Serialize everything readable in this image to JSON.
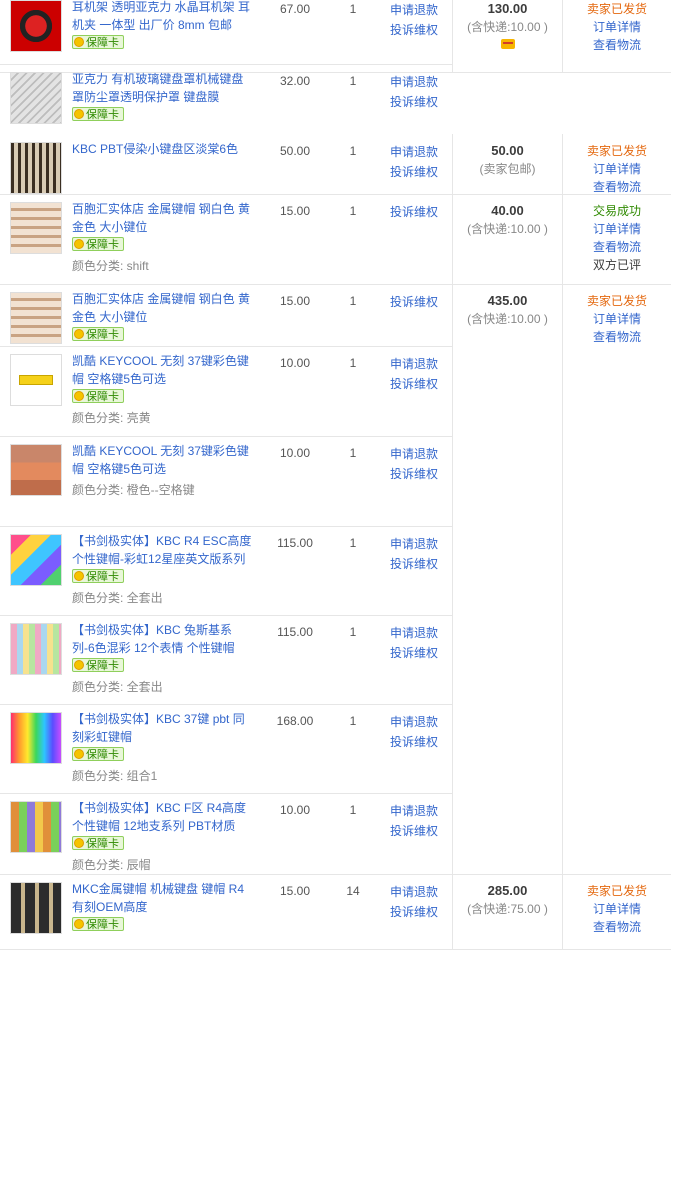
{
  "orders": [
    {
      "items": [
        {
          "thumb": "t-headphones",
          "title": "耳机架 透明亚克力 水晶耳机架 耳机夹 一体型 出厂价 8mm 包邮",
          "badge": "保障卡",
          "variant": "",
          "price": "67.00",
          "qty": "1",
          "actions": [
            "申请退款",
            "投诉维权"
          ]
        },
        {
          "thumb": "t-keyboard-cover",
          "title": "亚克力 有机玻璃键盘罩机械键盘罩防尘罩透明保护罩 键盘膜",
          "badge": "保障卡",
          "variant": "",
          "price": "32.00",
          "qty": "1",
          "actions": [
            "申请退款",
            "投诉维权"
          ]
        }
      ],
      "pay": {
        "total": "130.00",
        "ship": "(含快递:10.00 )",
        "card_icon": "credit-card-icon"
      },
      "status": {
        "state": "卖家已发货",
        "kind": "shipped",
        "links": [
          "订单详情",
          "查看物流"
        ],
        "extra": ""
      }
    },
    {
      "items": [
        {
          "thumb": "t-pbt",
          "title": "KBC PBT侵染小键盘区淡棠6色",
          "badge": "",
          "variant": "",
          "price": "50.00",
          "qty": "1",
          "actions": [
            "申请退款",
            "投诉维权"
          ]
        }
      ],
      "pay": {
        "total": "50.00",
        "ship": "(卖家包邮)"
      },
      "status": {
        "state": "卖家已发货",
        "kind": "shipped",
        "links": [
          "订单详情",
          "查看物流"
        ],
        "extra": ""
      }
    },
    {
      "items": [
        {
          "thumb": "t-metal",
          "title": "百胞汇实体店 金属键帽 钢白色 黄金色 大小键位",
          "badge": "保障卡",
          "variant": "颜色分类: shift",
          "price": "15.00",
          "qty": "1",
          "actions": [
            "投诉维权"
          ]
        }
      ],
      "pay": {
        "total": "40.00",
        "ship": "(含快递:10.00 )"
      },
      "status": {
        "state": "交易成功",
        "kind": "success",
        "links": [
          "订单详情",
          "查看物流"
        ],
        "extra": "双方已评"
      }
    },
    {
      "items": [
        {
          "thumb": "t-metal",
          "title": "百胞汇实体店 金属键帽 钢白色 黄金色 大小键位",
          "badge": "保障卡",
          "variant": "",
          "price": "15.00",
          "qty": "1",
          "actions": [
            "投诉维权"
          ]
        },
        {
          "thumb": "t-yellow",
          "title": "凯酷 KEYCOOL 无刻 37键彩色键帽 空格键5色可选",
          "badge": "保障卡",
          "variant": "颜色分类: 亮黄",
          "price": "10.00",
          "qty": "1",
          "actions": [
            "申请退款",
            "投诉维权"
          ]
        },
        {
          "thumb": "t-orange",
          "title": "凯酷 KEYCOOL 无刻 37键彩色键帽 空格键5色可选",
          "badge": "",
          "variant": "颜色分类: 橙色--空格键",
          "price": "10.00",
          "qty": "1",
          "actions": [
            "申请退款",
            "投诉维权"
          ]
        },
        {
          "thumb": "t-rainbow-r4",
          "title": "【书剑极实体】KBC R4 ESC高度 个性键帽-彩虹12星座英文版系列",
          "badge": "保障卡",
          "variant": "颜色分类: 全套出",
          "price": "115.00",
          "qty": "1",
          "actions": [
            "申请退款",
            "投诉维权"
          ]
        },
        {
          "thumb": "t-mix",
          "title": "【书剑极实体】KBC 兔斯基系列-6色混彩 12个表情 个性键帽",
          "badge": "保障卡",
          "variant": "颜色分类: 全套出",
          "price": "115.00",
          "qty": "1",
          "actions": [
            "申请退款",
            "投诉维权"
          ]
        },
        {
          "thumb": "t-37",
          "title": "【书剑极实体】KBC 37键 pbt 同刻彩虹键帽",
          "badge": "保障卡",
          "variant": "颜色分类: 组合1",
          "price": "168.00",
          "qty": "1",
          "actions": [
            "申请退款",
            "投诉维权"
          ]
        },
        {
          "thumb": "t-zodiac",
          "title": "【书剑极实体】KBC F区 R4高度 个性键帽 12地支系列 PBT材质",
          "badge": "保障卡",
          "variant": "颜色分类: 辰帽",
          "price": "10.00",
          "qty": "1",
          "actions": [
            "申请退款",
            "投诉维权"
          ]
        }
      ],
      "pay": {
        "total": "435.00",
        "ship": "(含快递:10.00 )"
      },
      "status": {
        "state": "卖家已发货",
        "kind": "shipped",
        "links": [
          "订单详情",
          "查看物流"
        ],
        "extra": ""
      }
    },
    {
      "items": [
        {
          "thumb": "t-mkc",
          "title": "MKC金属键帽 机械键盘 键帽 R4 有刻OEM高度",
          "badge": "保障卡",
          "variant": "",
          "price": "15.00",
          "qty": "14",
          "actions": [
            "申请退款",
            "投诉维权"
          ]
        }
      ],
      "pay": {
        "total": "285.00",
        "ship": "(含快递:75.00 )"
      },
      "status": {
        "state": "卖家已发货",
        "kind": "shipped",
        "links": [
          "订单详情",
          "查看物流"
        ],
        "extra": ""
      }
    }
  ]
}
